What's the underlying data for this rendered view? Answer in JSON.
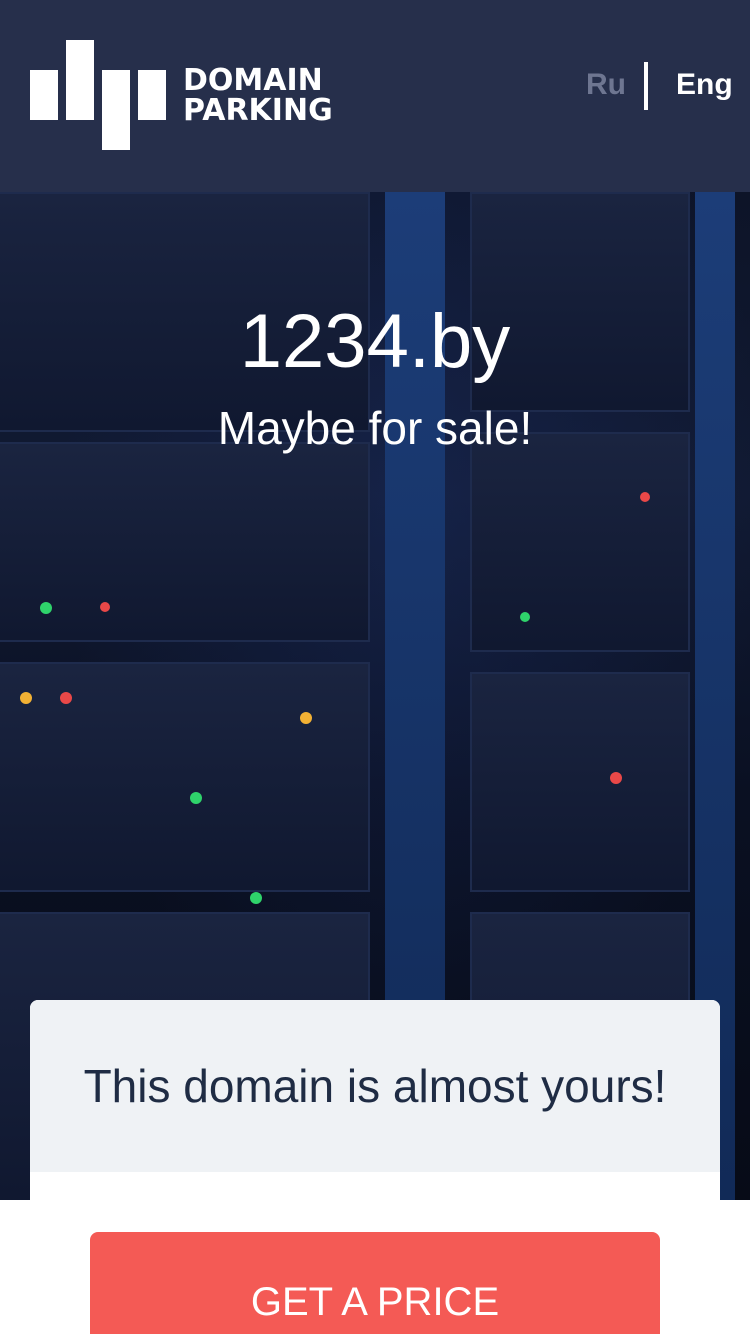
{
  "header": {
    "logo": {
      "line1": "DOMAIN",
      "line2": "PARKING"
    },
    "languages": {
      "ru": "Ru",
      "eng": "Eng"
    }
  },
  "hero": {
    "domain": "1234.by",
    "subtitle": "Maybe for sale!"
  },
  "card": {
    "title": "This domain is almost yours!",
    "button_label": "GET A PRICE"
  },
  "colors": {
    "header_bg": "#262f4b",
    "lang_inactive": "#6e7691",
    "button_bg": "#f45a55",
    "card_head_bg": "#eff2f5",
    "card_title": "#1f2c44"
  }
}
